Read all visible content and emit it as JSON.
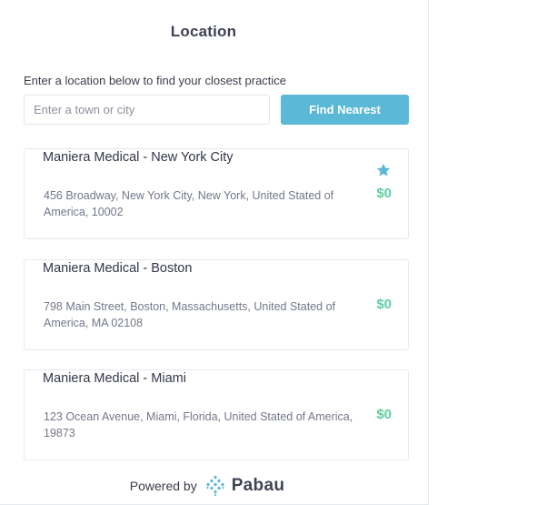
{
  "header": {
    "title": "Location"
  },
  "search": {
    "prompt": "Enter a location below to find your closest practice",
    "placeholder": "Enter a town or city",
    "button_label": "Find Nearest"
  },
  "locations": [
    {
      "name": "Maniera Medical - New York City",
      "address": "456 Broadway, New York City, New York, United Stated of America, 10002",
      "price": "$0",
      "starred": true
    },
    {
      "name": "Maniera Medical - Boston",
      "address": "798 Main Street, Boston, Massachusetts, United Stated of America, MA 02108",
      "price": "$0",
      "starred": false
    },
    {
      "name": "Maniera Medical - Miami",
      "address": "123 Ocean Avenue, Miami, Florida, United Stated of America, 19873",
      "price": "$0",
      "starred": false
    }
  ],
  "footer": {
    "powered_by": "Powered by",
    "brand": "Pabau"
  },
  "colors": {
    "accent": "#5bb8d6",
    "price": "#5dcf9f",
    "star": "#5bb8d6"
  }
}
